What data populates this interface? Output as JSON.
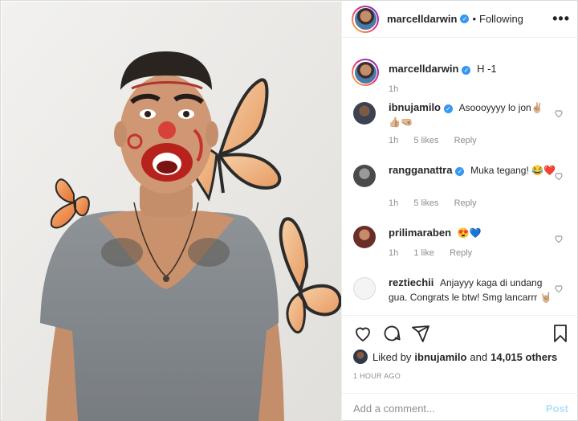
{
  "post": {
    "author": "marcelldarwin",
    "follow_status": "Following",
    "more_label": "•••"
  },
  "caption": {
    "username": "marcelldarwin",
    "text": "H -1",
    "time": "1h"
  },
  "comments": [
    {
      "username": "ibnujamilo",
      "verified": true,
      "text": "Asoooyyyy lo jon✌🏼 👍🏼🤜🏼",
      "time": "1h",
      "likes": "5 likes",
      "reply": "Reply"
    },
    {
      "username": "rangganattra",
      "verified": true,
      "text": "Muka tegang! 😂❤️",
      "time": "1h",
      "likes": "5 likes",
      "reply": "Reply"
    },
    {
      "username": "prilimaraben",
      "verified": false,
      "text": "😍💙",
      "time": "1h",
      "likes": "1 like",
      "reply": "Reply"
    },
    {
      "username": "reztiechii",
      "verified": false,
      "text": "Anjayyy kaga di undang gua. Congrats le btw! Smg lancarrr 🤘🏼",
      "time": "",
      "likes": "",
      "reply": ""
    }
  ],
  "likes": {
    "prefix": "Liked by",
    "user": "ibnujamilo",
    "joiner": "and",
    "others": "14,015 others"
  },
  "timestamp": "1 HOUR AGO",
  "add_comment": {
    "placeholder": "Add a comment...",
    "post_label": "Post"
  },
  "colors": {
    "verified": "#3897f0",
    "post_disabled": "#b2dffc",
    "secondary_text": "#8e8e8e",
    "border": "#efefef"
  },
  "icons": [
    "heart-icon",
    "comment-icon",
    "share-icon",
    "bookmark-icon",
    "more-icon",
    "verified-badge"
  ]
}
